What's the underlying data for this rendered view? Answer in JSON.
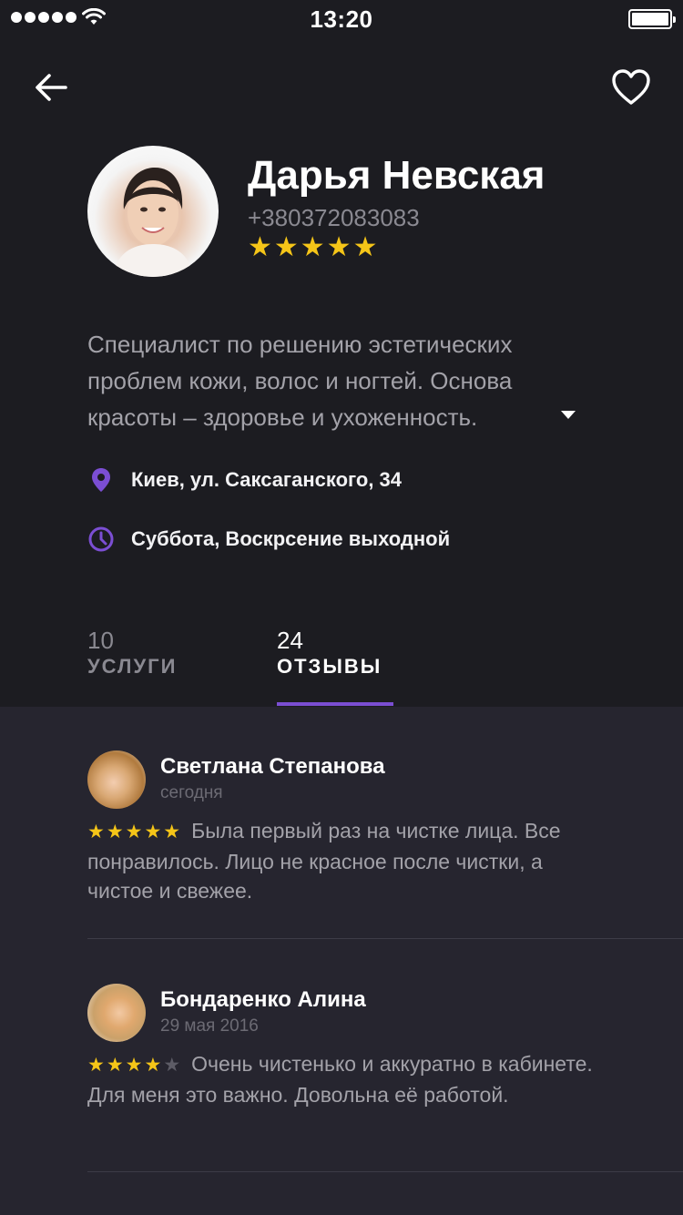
{
  "status_bar": {
    "time": "13:20"
  },
  "profile": {
    "name": "Дарья Невская",
    "phone": "+380372083083",
    "rating_stars": "★★★★★",
    "bio": "Специалист по решению эстетических проблем кожи, волос и ногтей. Основа красоты – здоровье и ухоженность.",
    "address": "Киев, ул. Саксаганского, 34",
    "hours": "Суббота, Воскрсение выходной"
  },
  "tabs": [
    {
      "count": "10",
      "label": "УСЛУГИ",
      "active": false
    },
    {
      "count": "24",
      "label": "ОТЗЫВЫ",
      "active": true
    }
  ],
  "reviews": [
    {
      "name": "Светлана Степанова",
      "date": "сегодня",
      "stars_on": "★★★★★",
      "stars_off": "",
      "rating": 5,
      "text": "Была первый раз на чистке лица. Все понравилось. Лицо не красное после чистки, а чистое и свежее."
    },
    {
      "name": "Бондаренко Алина",
      "date": "29 мая 2016",
      "stars_on": "★★★★",
      "stars_off": "★",
      "rating": 4,
      "text": "Очень чистенько и аккуратно в кабинете. Для меня это важно. Довольна её работой."
    }
  ],
  "colors": {
    "header_bg": "#1c1c21",
    "list_bg": "#26252f",
    "accent": "#7b4ed3",
    "star": "#f5c518"
  },
  "icons": [
    "back-arrow-icon",
    "heart-icon",
    "map-pin-icon",
    "clock-icon",
    "caret-down-icon",
    "wifi-icon",
    "battery-icon"
  ]
}
